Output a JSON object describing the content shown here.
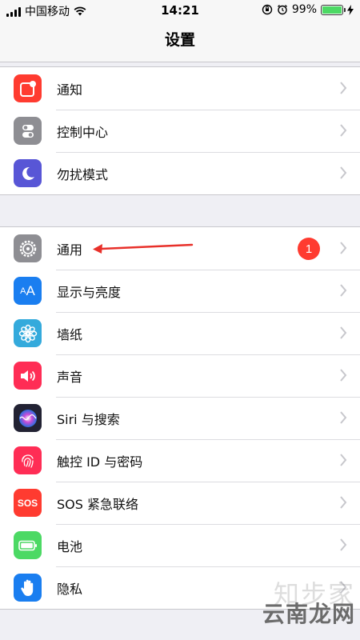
{
  "status_bar": {
    "carrier": "中国移动",
    "time": "14:21",
    "battery_percent": "99%",
    "battery_level": 0.99
  },
  "nav": {
    "title": "设置"
  },
  "group1": [
    {
      "label": "通知",
      "icon": "notifications-icon",
      "color": "#ff3b30"
    },
    {
      "label": "控制中心",
      "icon": "control-center-icon",
      "color": "#8e8e93"
    },
    {
      "label": "勿扰模式",
      "icon": "do-not-disturb-icon",
      "color": "#5856d6"
    }
  ],
  "group2": [
    {
      "label": "通用",
      "icon": "general-gear-icon",
      "color": "#8e8e93",
      "badge": "1"
    },
    {
      "label": "显示与亮度",
      "icon": "display-brightness-icon",
      "color": "#1a7ef0",
      "glyph": "AA"
    },
    {
      "label": "墙纸",
      "icon": "wallpaper-icon",
      "color": "#34aadc"
    },
    {
      "label": "声音",
      "icon": "sounds-icon",
      "color": "#ff2d55"
    },
    {
      "label": "Siri 与搜索",
      "icon": "siri-icon",
      "color": "#222233"
    },
    {
      "label": "触控 ID 与密码",
      "icon": "touch-id-icon",
      "color": "#ff2d55"
    },
    {
      "label": "SOS 紧急联络",
      "icon": "sos-icon",
      "color": "#ff3b30",
      "glyph": "SOS"
    },
    {
      "label": "电池",
      "icon": "battery-icon",
      "color": "#4cd964"
    },
    {
      "label": "隐私",
      "icon": "privacy-hand-icon",
      "color": "#1a7ef0"
    }
  ],
  "watermark": {
    "text": "云南龙网",
    "faint_text": "知步家"
  }
}
